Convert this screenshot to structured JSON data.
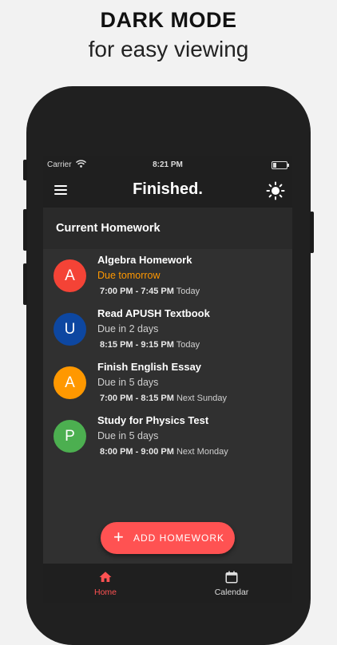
{
  "promo": {
    "title": "DARK MODE",
    "subtitle": "for easy viewing"
  },
  "status_bar": {
    "carrier": "Carrier",
    "time": "8:21 PM"
  },
  "app_bar": {
    "title": "Finished."
  },
  "section": {
    "title": "Current Homework"
  },
  "homework": [
    {
      "initial": "A",
      "color": "#f44336",
      "title": "Algebra Homework",
      "due": "Due tomorrow",
      "due_urgent": true,
      "time_range": "7:00 PM - 7:45 PM",
      "day": "Today"
    },
    {
      "initial": "U",
      "color": "#0d47a1",
      "title": "Read APUSH Textbook",
      "due": "Due in 2 days",
      "due_urgent": false,
      "time_range": "8:15 PM - 9:15 PM",
      "day": "Today"
    },
    {
      "initial": "A",
      "color": "#ff9800",
      "title": "Finish English Essay",
      "due": "Due in 5 days",
      "due_urgent": false,
      "time_range": "7:00 PM - 8:15 PM",
      "day": "Next Sunday"
    },
    {
      "initial": "P",
      "color": "#4caf50",
      "title": "Study for Physics Test",
      "due": "Due in 5 days",
      "due_urgent": false,
      "time_range": "8:00 PM - 9:00 PM",
      "day": "Next Monday"
    }
  ],
  "add_button": {
    "label": "ADD HOMEWORK",
    "color": "#ff5252"
  },
  "bottom_nav": {
    "home_label": "Home",
    "calendar_label": "Calendar"
  },
  "icons": {
    "menu": "menu-icon",
    "theme": "sun-icon",
    "wifi": "wifi-icon",
    "add": "plus-icon",
    "home": "home-icon",
    "calendar": "calendar-icon"
  },
  "colors": {
    "accent": "#ff5252",
    "background": "#303030",
    "bar": "#1f1f1f",
    "due_urgent": "#ff9800"
  }
}
